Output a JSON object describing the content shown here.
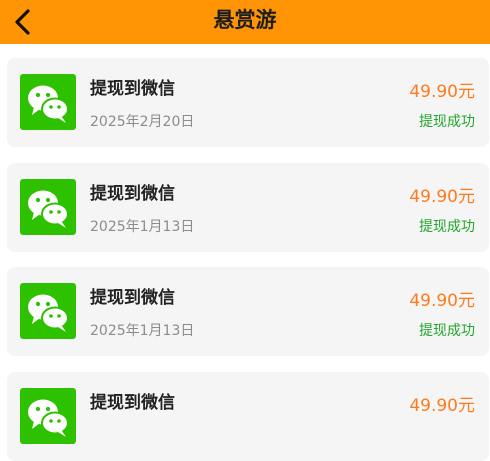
{
  "header": {
    "title": "悬赏游",
    "back_icon": "chevron-left-icon",
    "background_color": "#ff9405"
  },
  "records": [
    {
      "title": "提现到微信",
      "date": "2025年2月20日",
      "amount": "49.90元",
      "status": "提现成功",
      "icon": "wechat-icon"
    },
    {
      "title": "提现到微信",
      "date": "2025年1月13日",
      "amount": "49.90元",
      "status": "提现成功",
      "icon": "wechat-icon"
    },
    {
      "title": "提现到微信",
      "date": "2025年1月13日",
      "amount": "49.90元",
      "status": "提现成功",
      "icon": "wechat-icon"
    },
    {
      "title": "提现到微信",
      "date": "",
      "amount": "49.90元",
      "status": "",
      "icon": "wechat-icon"
    }
  ],
  "colors": {
    "accent": "#ff9405",
    "amount": "#ff7a1a",
    "status_success": "#22a62c",
    "wechat_green": "#2dc100"
  }
}
